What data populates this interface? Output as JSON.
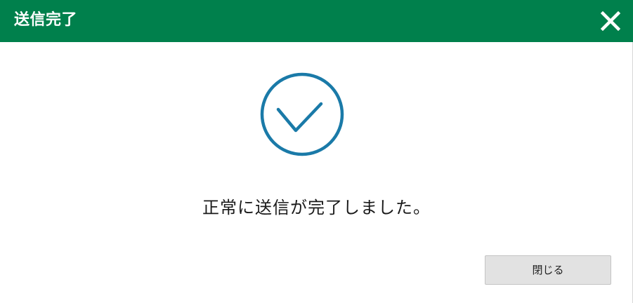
{
  "dialog": {
    "title": "送信完了",
    "message": "正常に送信が完了しました。",
    "close_button_label": "閉じる"
  },
  "icons": {
    "close": "close-icon",
    "success": "checkmark-circle-icon"
  },
  "colors": {
    "header_bg": "#00804c",
    "header_text": "#ffffff",
    "check_accent": "#1a7aa8",
    "button_bg": "#e2e2e2"
  }
}
